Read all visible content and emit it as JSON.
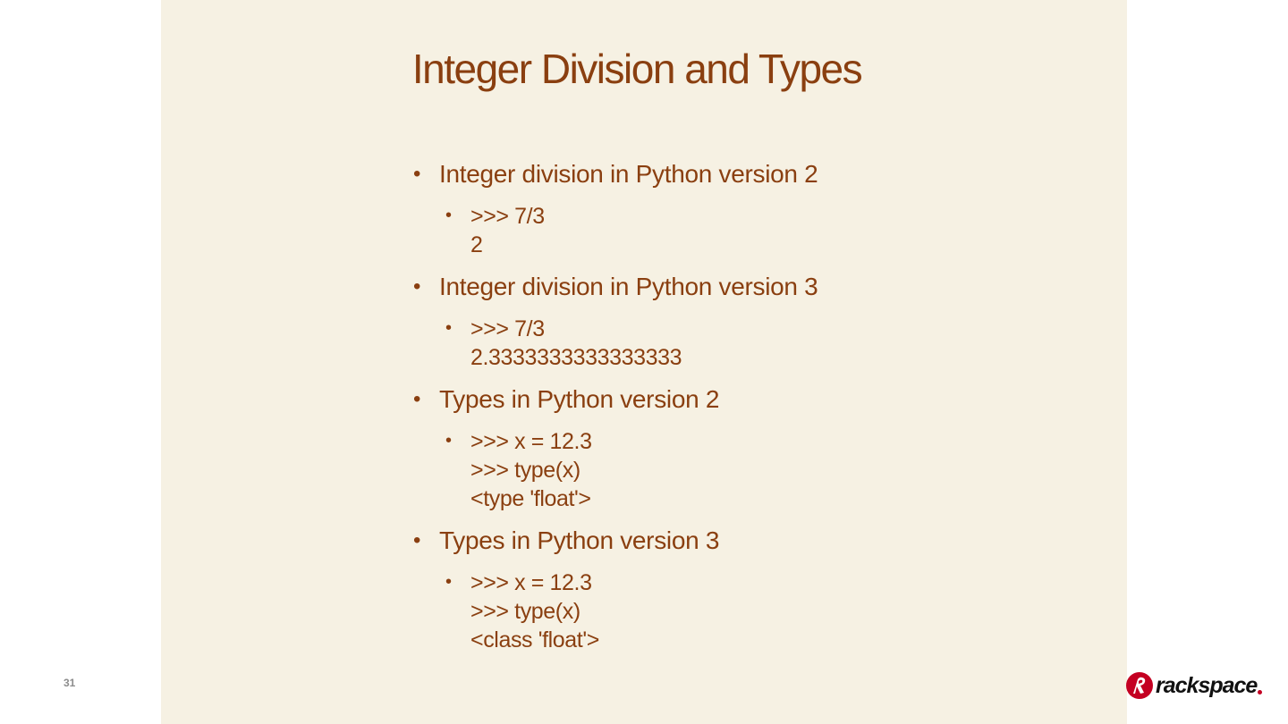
{
  "slide": {
    "title": "Integer Division and Types",
    "page_number": "31",
    "bullets": [
      {
        "label": "Integer division in Python version 2",
        "sub": [
          [
            ">>> 7/3",
            "2"
          ]
        ]
      },
      {
        "label": "Integer division in Python version 3",
        "sub": [
          [
            ">>> 7/3",
            "2.3333333333333333"
          ]
        ]
      },
      {
        "label": "Types in Python version 2",
        "sub": [
          [
            ">>> x = 12.3",
            ">>> type(x)",
            "<type 'float'>"
          ]
        ]
      },
      {
        "label": "Types in Python version 3",
        "sub": [
          [
            ">>> x = 12.3",
            ">>> type(x)",
            "<class 'float'>"
          ]
        ]
      }
    ]
  },
  "logo": {
    "text": "rackspace",
    "icon": "rackspace-logo-icon"
  },
  "colors": {
    "accent": "#8a3f10",
    "panel_background": "#f6f1e3",
    "logo_red": "#c40022"
  }
}
